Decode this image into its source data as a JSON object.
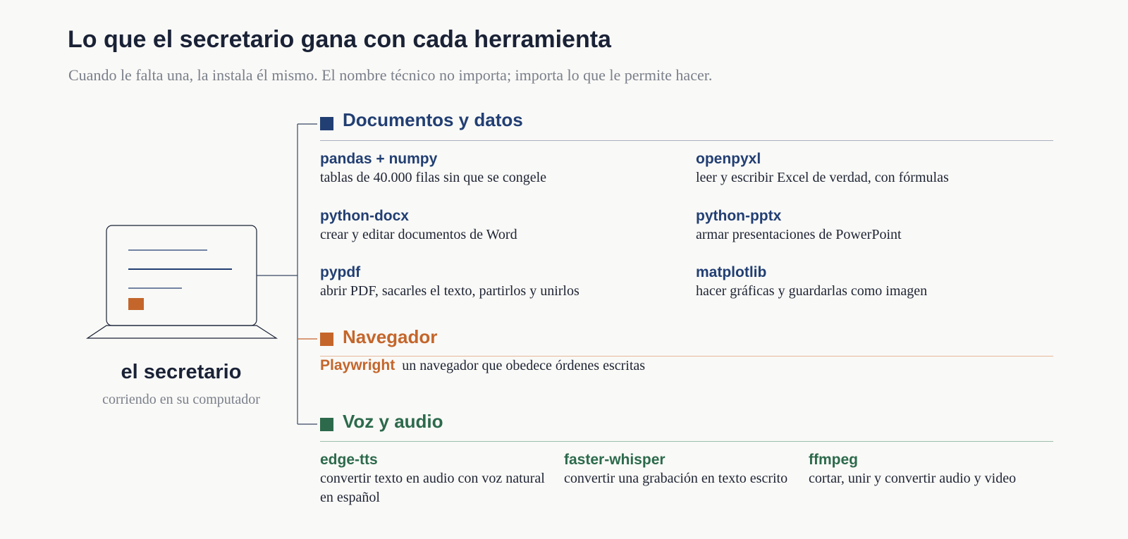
{
  "header": {
    "title": "Lo que el secretario gana con cada herramienta",
    "subtitle": "Cuando le falta una, la instala él mismo. El nombre técnico no importa; importa lo que le permite hacer."
  },
  "computer": {
    "icon": "laptop-icon",
    "name": "el secretario",
    "caption": "corriendo en su computador"
  },
  "colors": {
    "text": "#1e2433",
    "muted": "#7a7f8a",
    "documentos": "#223f73",
    "navegador": "#c4662b",
    "voz": "#2c6a4b",
    "laptop_outline": "#1a2236"
  },
  "sections": {
    "documentos": {
      "title": "Documentos y datos",
      "tools": [
        {
          "name": "pandas + numpy",
          "desc": "tablas de 40.000 filas sin que se congele"
        },
        {
          "name": "openpyxl",
          "desc": "leer y escribir Excel de verdad, con fórmulas"
        },
        {
          "name": "python-docx",
          "desc": "crear y editar documentos de Word"
        },
        {
          "name": "python-pptx",
          "desc": "armar presentaciones de PowerPoint"
        },
        {
          "name": "pypdf",
          "desc": "abrir PDF, sacarles el texto, partirlos y unirlos"
        },
        {
          "name": "matplotlib",
          "desc": "hacer gráficas y guardarlas como imagen"
        }
      ]
    },
    "navegador": {
      "title": "Navegador",
      "tools": [
        {
          "name": "Playwright",
          "desc": "un navegador que obedece órdenes escritas"
        }
      ]
    },
    "voz": {
      "title": "Voz y audio",
      "tools": [
        {
          "name": "edge-tts",
          "desc": "convertir texto en audio con voz natural en español"
        },
        {
          "name": "faster-whisper",
          "desc": "convertir una grabación en texto escrito"
        },
        {
          "name": "ffmpeg",
          "desc": "cortar, unir y convertir audio y video"
        }
      ]
    }
  }
}
